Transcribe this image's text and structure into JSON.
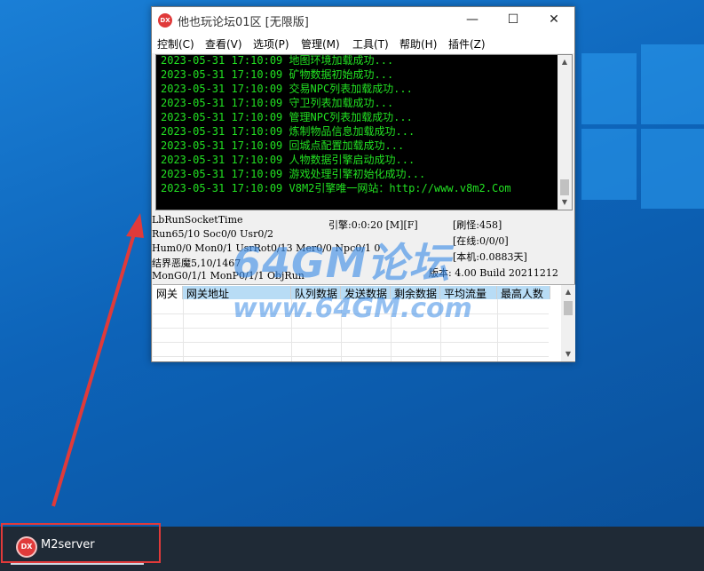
{
  "window": {
    "icon_text": "DX",
    "title": "他也玩论坛01区 [无限版]",
    "minimize": "—",
    "maximize": "☐",
    "close": "✕"
  },
  "menu": [
    "控制(C)",
    "查看(V)",
    "选项(P)",
    "管理(M)",
    "工具(T)",
    "帮助(H)",
    "插件(Z)"
  ],
  "log": [
    "2023-05-31 17:10:09 地图环境加载成功...",
    "2023-05-31 17:10:09 矿物数据初始成功...",
    "2023-05-31 17:10:09 交易NPC列表加载成功...",
    "2023-05-31 17:10:09 守卫列表加载成功...",
    "2023-05-31 17:10:09 管理NPC列表加载成功...",
    "2023-05-31 17:10:09 炼制物品信息加载成功...",
    "2023-05-31 17:10:09 回城点配置加载成功...",
    "2023-05-31 17:10:09 人物数据引擎启动成功...",
    "2023-05-31 17:10:09 游戏处理引擎初始化成功...",
    "2023-05-31 17:10:09 V8M2引擎唯一网站：http://www.v8m2.Com"
  ],
  "status": {
    "socket_time": "LbRunSocketTime",
    "run": "Run65/10 Soc0/0 Usr0/2",
    "hum": "Hum0/0 Mon0/1 UsrRot0/13 Mer0/0 Npc0/1 0",
    "monster": "结界恶魔5,10/1467",
    "mong": "MonG0/1/1 MonP0/1/1 ObjRun",
    "engine": "引擎:0:0:20 [M][F]",
    "refresh": "[刷怪:458]",
    "online": "[在线:0/0/0]",
    "local": "[本机:0.0883天]",
    "version": "版本: 4.00 Build 20211212"
  },
  "grid": {
    "columns": [
      "网关",
      "网关地址",
      "队列数据",
      "发送数据",
      "剩余数据",
      "平均流量",
      "最高人数"
    ]
  },
  "watermark": {
    "line1": "64GM论坛",
    "line2": "www.64GM.com"
  },
  "taskbar": {
    "icon_text": "DX",
    "label": "M2server"
  },
  "colors": {
    "console_text": "#22e022",
    "highlight": "#e03a3a",
    "grid_header": "#b8dcf5"
  }
}
